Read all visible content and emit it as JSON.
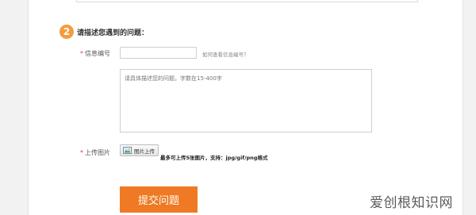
{
  "form": {
    "step_number": "2",
    "step_title": "请描述您遇到的问题：",
    "id_field": {
      "required_mark": "*",
      "label": "信息编号",
      "value": "",
      "help_link": "如何查看信息编号？"
    },
    "description": {
      "placeholder": "请具体描述您的问题，字数在15-400字",
      "value": ""
    },
    "upload": {
      "required_mark": "*",
      "label": "上传图片",
      "button_label": "图片上传",
      "icon": "picture-icon",
      "hint": "最多可上传5张图片，支持：jpg/gif/png格式"
    },
    "submit_label": "提交问题"
  },
  "watermark": {
    "text": "爱创根知识网"
  },
  "colors": {
    "accent": "#ef7a23",
    "step_badge": "#f39c3d",
    "required": "#e4393c"
  }
}
